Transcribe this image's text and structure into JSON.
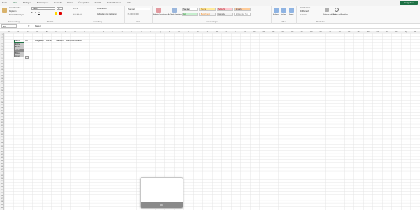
{
  "menu": {
    "items": [
      "Datei",
      "Start",
      "Einfügen",
      "Seitenlayout",
      "Formeln",
      "Daten",
      "Überprüfen",
      "Ansicht",
      "Entwicklertools",
      "Hilfe"
    ],
    "active_index": 1,
    "share_label": "Freigeben"
  },
  "ribbon": {
    "clipboard": {
      "label": "Zwischenablage",
      "paste": "Einfügen",
      "cut": "Ausschneiden",
      "copy": "Kopieren",
      "format": "Format übertragen"
    },
    "font": {
      "label": "Schriftart",
      "name": "Calibri",
      "size": "11"
    },
    "alignment": {
      "label": "Ausrichtung",
      "wrap": "Textumbruch",
      "merge": "Verbinden und zentrieren"
    },
    "number": {
      "label": "Zahl",
      "format": "Standard"
    },
    "styles": {
      "label": "Formatvorlagen",
      "conditional": "Bedingte Formatierung",
      "as_table": "Als Tabelle formatieren",
      "cells": [
        {
          "text": "Standard",
          "bg": "#ffffff",
          "fg": "#000000"
        },
        {
          "text": "Gut",
          "bg": "#c6efce",
          "fg": "#006100"
        },
        {
          "text": "Neutral",
          "bg": "#ffeb9c",
          "fg": "#9c5700"
        },
        {
          "text": "Berechnung",
          "bg": "#f2f2f2",
          "fg": "#fa7d00"
        },
        {
          "text": "Schlecht",
          "bg": "#ffc7ce",
          "fg": "#9c0006"
        },
        {
          "text": "Ausgabe",
          "bg": "#f2f2f2",
          "fg": "#3f3f3f"
        },
        {
          "text": "Eingabe",
          "bg": "#ffcc99",
          "fg": "#3f3f76"
        },
        {
          "text": "Erklärender Text",
          "bg": "#ffffff",
          "fg": "#7f7f7f"
        }
      ]
    },
    "cells": {
      "label": "Zellen",
      "insert": "Einfügen",
      "delete": "Löschen",
      "format": "Format"
    },
    "editing": {
      "label": "Bearbeiten",
      "autosum": "AutoSumme",
      "fill": "Füllbereich",
      "clear": "Löschen",
      "sort": "Sortieren und Filtern",
      "find": "Suchen und Auswählen"
    }
  },
  "formula_bar": {
    "name_box": "B3",
    "fx": "fx",
    "value": "Kiefer"
  },
  "columns": [
    "A",
    "B",
    "C",
    "D",
    "E",
    "F",
    "G",
    "H",
    "I",
    "J",
    "K",
    "L",
    "M",
    "N",
    "O",
    "P",
    "Q",
    "R",
    "S",
    "T",
    "U",
    "V",
    "W",
    "X",
    "Y",
    "Z",
    "AA",
    "AB",
    "AC",
    "AD",
    "AE",
    "AF",
    "AG",
    "AH",
    "AI",
    "AJ",
    "AK",
    "AL",
    "AM",
    "AN",
    "AO",
    "AP",
    "AQ",
    "AR"
  ],
  "sheet": {
    "headers": [
      "Baum",
      "Ort",
      "Ausgaben",
      "Anzahl",
      "Standort",
      "Bemerkungsraum"
    ],
    "dropdown_options": [
      "Eiche",
      "Buche",
      "Kiefer",
      "Birke",
      "Ahorn"
    ],
    "dropdown_selected": 2
  },
  "popup": {
    "button_label": "OK"
  }
}
